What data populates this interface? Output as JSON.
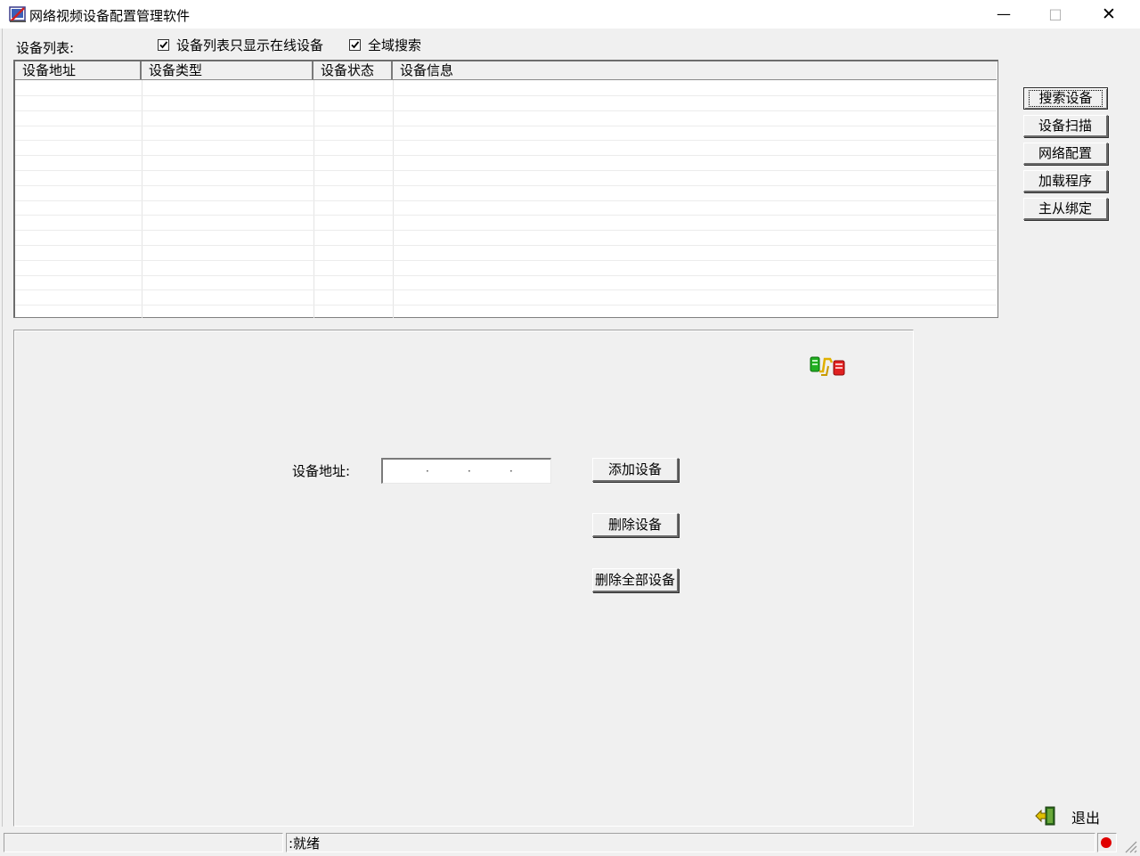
{
  "window": {
    "title": "网络视频设备配置管理软件",
    "controls": {
      "minimize": "—",
      "maximize": "□",
      "close": "✕"
    }
  },
  "device_list": {
    "label": "设备列表:",
    "options": [
      {
        "label": "设备列表只显示在线设备",
        "checked": true
      },
      {
        "label": "全域搜索",
        "checked": true
      }
    ],
    "columns": [
      "设备地址",
      "设备类型",
      "设备状态",
      "设备信息"
    ],
    "rows": []
  },
  "side_buttons": {
    "search": "搜索设备",
    "scan": "设备扫描",
    "net_config": "网络配置",
    "load_program": "加载程序",
    "master_slave_bind": "主从绑定"
  },
  "device_edit": {
    "address_label": "设备地址:",
    "address_value": "",
    "add_button": "添加设备",
    "delete_button": "删除设备",
    "delete_all_button": "删除全部设备"
  },
  "exit": {
    "label": "退出"
  },
  "status_bar": {
    "status_text": ":就绪",
    "led_color": "#e00000"
  },
  "icons": {
    "app": "app-icon",
    "network": "network-connection-icon",
    "exit": "exit-door-icon"
  }
}
